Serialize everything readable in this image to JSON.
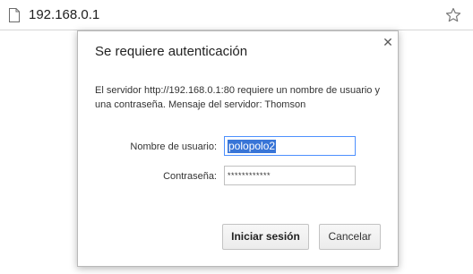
{
  "browser": {
    "url": "192.168.0.1",
    "page_icon": "page-icon",
    "bookmark_icon": "star-icon"
  },
  "dialog": {
    "title": "Se requiere autenticación",
    "close_icon": "close-icon",
    "message": "El servidor http://192.168.0.1:80 requiere un nombre de usuario y una contraseña. Mensaje del servidor: Thomson",
    "username_label": "Nombre de usuario:",
    "username_value": "polopolo2",
    "password_label": "Contraseña:",
    "password_value": "************",
    "login_button": "Iniciar sesión",
    "cancel_button": "Cancelar"
  },
  "colors": {
    "focus_border": "#4d90fe",
    "selection": "#3875d7"
  }
}
